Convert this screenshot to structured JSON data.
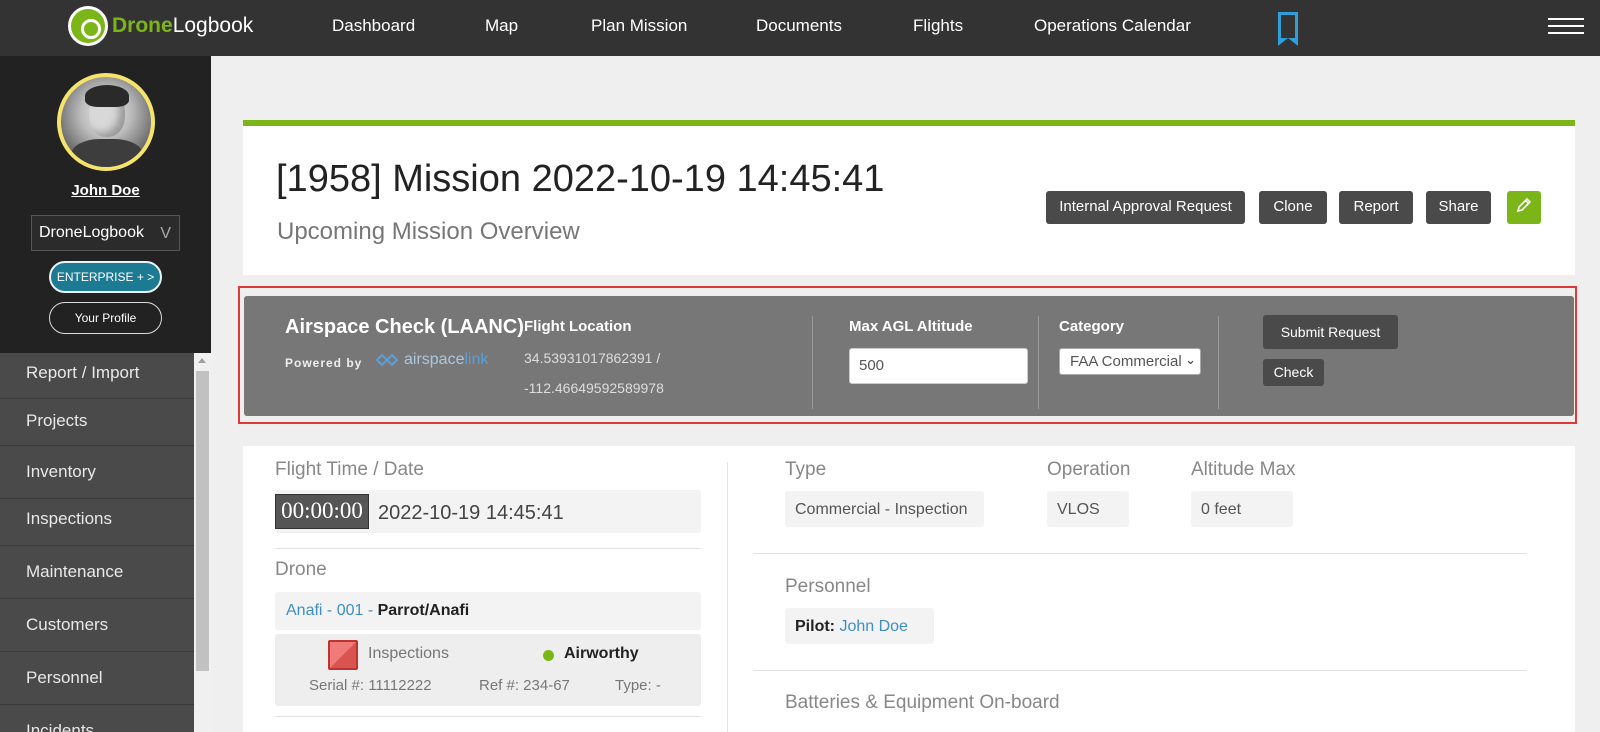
{
  "app": {
    "logo_brand": "Drone",
    "logo_rest": "Logbook",
    "nav": [
      "Dashboard",
      "Map",
      "Plan Mission",
      "Documents",
      "Flights",
      "Operations Calendar"
    ],
    "icons": {
      "bookmark": "bookmark-icon",
      "menu": "hamburger-icon"
    },
    "colors": {
      "accent": "#7cb518",
      "link": "#3d8fc6",
      "bookmark": "#2e9fd8",
      "alert_outline": "#e0373a"
    }
  },
  "sidebar": {
    "user_name": "John Doe",
    "org_select": "DroneLogbook",
    "org_chevron": "V",
    "enterprise_label": "ENTERPRISE + >",
    "profile_label": "Your Profile",
    "menu": [
      "Report / Import",
      "Projects",
      "Inventory",
      "Inspections",
      "Maintenance",
      "Customers",
      "Personnel",
      "Incidents"
    ]
  },
  "mission": {
    "title": "[1958] Mission 2022-10-19 14:45:41",
    "subtitle": "Upcoming Mission Overview",
    "buttons": {
      "internal_approval": "Internal Approval Request",
      "clone": "Clone",
      "report": "Report",
      "share": "Share",
      "edit_icon": "pencil-icon"
    }
  },
  "airspace": {
    "title": "Airspace Check (LAANC)",
    "powered_by": "Powered by",
    "provider_a": "airspace",
    "provider_b": "link",
    "flight_location_label": "Flight Location",
    "lat": "34.53931017862391 /",
    "lng": "-112.46649592589978",
    "max_agl_label": "Max AGL Altitude",
    "max_agl_value": "500",
    "category_label": "Category",
    "category_value": "FAA Commercial",
    "submit_label": "Submit Request",
    "check_label": "Check"
  },
  "details": {
    "flight_time_label": "Flight Time / Date",
    "timer": "00:00:00",
    "date": "2022-10-19 14:45:41",
    "drone_label": "Drone",
    "drone_link": "Anafi - 001 -",
    "drone_model": "Parrot/Anafi",
    "inspections_label": "Inspections",
    "status": "Airworthy",
    "serial": "Serial #: 11112222",
    "ref": "Ref #: 234-67",
    "type_small": "Type: -",
    "type_label": "Type",
    "type_value": "Commercial - Inspection",
    "operation_label": "Operation",
    "operation_value": "VLOS",
    "altitude_label": "Altitude Max",
    "altitude_value": "0 feet",
    "personnel_label": "Personnel",
    "pilot_label": "Pilot:",
    "pilot_name": "John Doe",
    "batteries_label": "Batteries & Equipment On-board"
  }
}
